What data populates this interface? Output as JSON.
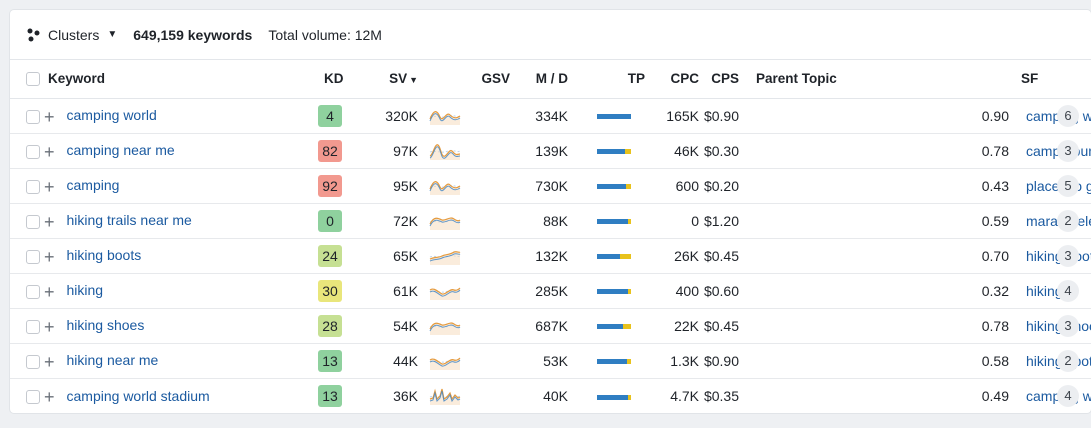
{
  "toolbar": {
    "clusters_label": "Clusters",
    "keyword_count": "649,159 keywords",
    "total_volume": "Total volume: 12M"
  },
  "columns": {
    "keyword": "Keyword",
    "kd": "KD",
    "sv": "SV",
    "gsv": "GSV",
    "md": "M / D",
    "tp": "TP",
    "cpc": "CPC",
    "cps": "CPS",
    "parent_topic": "Parent Topic",
    "sf": "SF"
  },
  "colors": {
    "kd_green": "#8fd19e",
    "kd_red": "#f2998f",
    "kd_yellowgreen": "#c6e093",
    "kd_yellow": "#e9e67b",
    "link": "#1b5aa0",
    "bar_blue": "#2f7ec2",
    "bar_yellow": "#e8c21c"
  },
  "rows": [
    {
      "keyword": "camping world",
      "kd": "4",
      "kd_color": "#8fd19e",
      "sv": "320K",
      "gsv": "334K",
      "md_mobile": 1.0,
      "tp": "165K",
      "cpc": "$0.90",
      "cps": "0.90",
      "parent_topic": "camping world",
      "sf": "6",
      "spark": "wave"
    },
    {
      "keyword": "camping near me",
      "kd": "82",
      "kd_color": "#f2998f",
      "sv": "97K",
      "gsv": "139K",
      "md_mobile": 0.85,
      "tp": "46K",
      "cpc": "$0.30",
      "cps": "0.78",
      "parent_topic": "campgrounds near me",
      "sf": "3",
      "spark": "peak"
    },
    {
      "keyword": "camping",
      "kd": "92",
      "kd_color": "#f2998f",
      "sv": "95K",
      "gsv": "730K",
      "md_mobile": 0.88,
      "tp": "600",
      "cpc": "$0.20",
      "cps": "0.43",
      "parent_topic": "places to go forest camping",
      "sf": "5",
      "spark": "wave"
    },
    {
      "keyword": "hiking trails near me",
      "kd": "0",
      "kd_color": "#8fd19e",
      "sv": "72K",
      "gsv": "88K",
      "md_mobile": 0.93,
      "tp": "0",
      "cpc": "$1.20",
      "cps": "0.59",
      "parent_topic": "marana elevation",
      "sf": "2",
      "spark": "hump"
    },
    {
      "keyword": "hiking boots",
      "kd": "24",
      "kd_color": "#c6e093",
      "sv": "65K",
      "gsv": "132K",
      "md_mobile": 0.7,
      "tp": "26K",
      "cpc": "$0.45",
      "cps": "0.70",
      "parent_topic": "hiking boots",
      "sf": "3",
      "spark": "rise"
    },
    {
      "keyword": "hiking",
      "kd": "30",
      "kd_color": "#e9e67b",
      "sv": "61K",
      "gsv": "285K",
      "md_mobile": 0.92,
      "tp": "400",
      "cpc": "$0.60",
      "cps": "0.32",
      "parent_topic": "hiking",
      "sf": "4",
      "spark": "dip"
    },
    {
      "keyword": "hiking shoes",
      "kd": "28",
      "kd_color": "#c6e093",
      "sv": "54K",
      "gsv": "687K",
      "md_mobile": 0.78,
      "tp": "22K",
      "cpc": "$0.45",
      "cps": "0.78",
      "parent_topic": "hiking shoes",
      "sf": "3",
      "spark": "hump"
    },
    {
      "keyword": "hiking near me",
      "kd": "13",
      "kd_color": "#8fd19e",
      "sv": "44K",
      "gsv": "53K",
      "md_mobile": 0.9,
      "tp": "1.3K",
      "cpc": "$0.90",
      "cps": "0.58",
      "parent_topic": "hiking spots near me",
      "sf": "2",
      "spark": "dip"
    },
    {
      "keyword": "camping world stadium",
      "kd": "13",
      "kd_color": "#8fd19e",
      "sv": "36K",
      "gsv": "40K",
      "md_mobile": 0.93,
      "tp": "4.7K",
      "cpc": "$0.35",
      "cps": "0.49",
      "parent_topic": "camping world stadium",
      "sf": "4",
      "spark": "spiky"
    }
  ]
}
